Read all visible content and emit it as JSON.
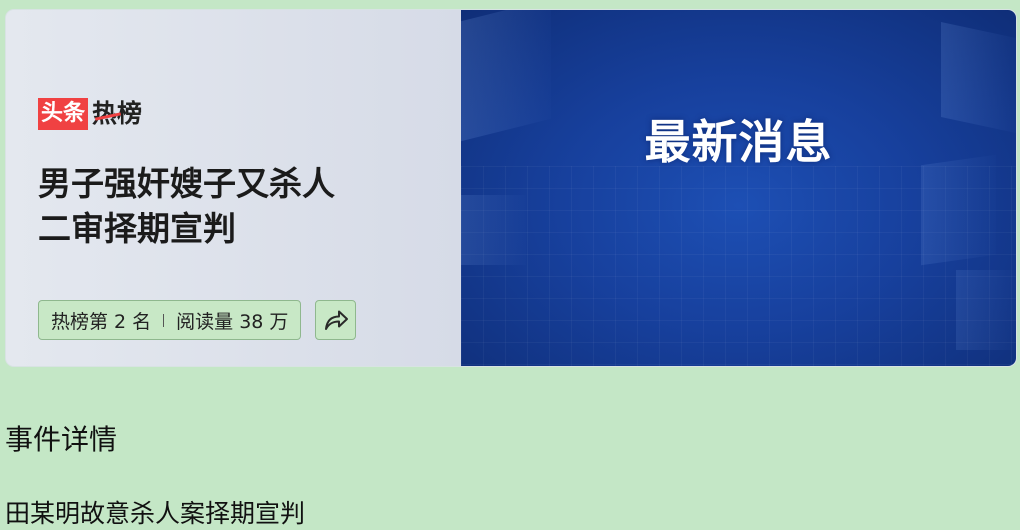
{
  "card": {
    "brand": {
      "toutiao": "头条",
      "rebang": "热榜"
    },
    "headline_line1": "男子强奸嫂子又杀人",
    "headline_line2": "二审择期宣判",
    "stats": {
      "rank": "热榜第 2 名",
      "reads": "阅读量 38 万"
    },
    "share_icon": "share-arrow-icon",
    "image_title": "最新消息"
  },
  "section": {
    "heading": "事件详情",
    "body": "田某明故意杀人案择期宣判"
  },
  "colors": {
    "page_background": "#c4e7c6",
    "brand_red": "#f04142",
    "news_blue": "#17409d"
  }
}
